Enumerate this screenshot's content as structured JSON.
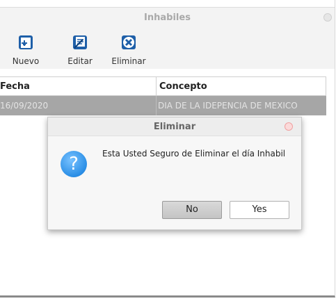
{
  "window": {
    "title": "Inhabiles"
  },
  "toolbar": {
    "items": [
      {
        "label": "Nuevo",
        "icon": "new-document-icon"
      },
      {
        "label": "Editar",
        "icon": "edit-document-icon"
      },
      {
        "label": "Eliminar",
        "icon": "delete-x-icon"
      }
    ]
  },
  "table": {
    "columns": [
      "Fecha",
      "Concepto"
    ],
    "rows": [
      {
        "fecha": "16/09/2020",
        "concepto": "DIA DE LA IDEPENCIA DE MEXICO"
      }
    ]
  },
  "dialog": {
    "title": "Eliminar",
    "icon": "question-icon",
    "message": "Esta Usted Seguro de Eliminar el día Inhabil",
    "no_label": "No",
    "yes_label": "Yes"
  },
  "colors": {
    "icon_blue": "#1e6fc0",
    "selected_row": "#a6a6a6",
    "dialog_close": "#f0a0a0"
  }
}
